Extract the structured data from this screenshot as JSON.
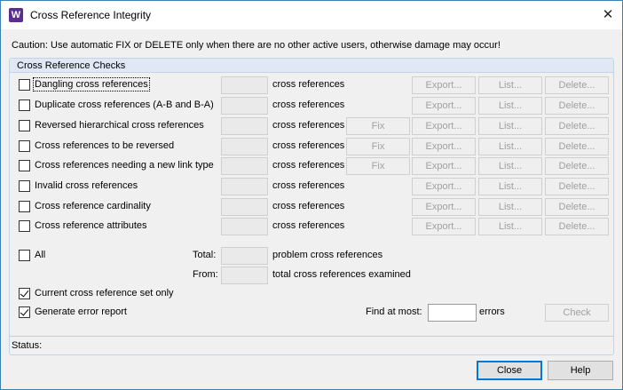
{
  "window": {
    "title": "Cross Reference Integrity",
    "app_icon_letter": "W",
    "close_glyph": "✕"
  },
  "caution": "Caution: Use automatic FIX or DELETE only when there are no other active users, otherwise damage may occur!",
  "group_title": "Cross Reference Checks",
  "suffix": "cross references",
  "buttons": {
    "fix": "Fix",
    "export": "Export...",
    "list": "List...",
    "delete": "Delete..."
  },
  "checks": [
    {
      "label": "Dangling cross references",
      "checked": false,
      "has_fix": false
    },
    {
      "label": "Duplicate cross references (A-B and B-A)",
      "checked": false,
      "has_fix": false
    },
    {
      "label": "Reversed hierarchical cross references",
      "checked": false,
      "has_fix": true
    },
    {
      "label": "Cross references to be reversed",
      "checked": false,
      "has_fix": true
    },
    {
      "label": "Cross references needing a new link type",
      "checked": false,
      "has_fix": true
    },
    {
      "label": "Invalid cross references",
      "checked": false,
      "has_fix": false
    },
    {
      "label": "Cross reference cardinality",
      "checked": false,
      "has_fix": false
    },
    {
      "label": "Cross reference attributes",
      "checked": false,
      "has_fix": false
    }
  ],
  "all": {
    "label": "All",
    "checked": false
  },
  "totals": {
    "total_label": "Total:",
    "total_suffix": "problem cross references",
    "from_label": "From:",
    "from_suffix": "total cross references examined"
  },
  "options": {
    "current_set": {
      "label": "Current cross reference set only",
      "checked": true
    },
    "error_report": {
      "label": "Generate error report",
      "checked": true
    }
  },
  "find": {
    "label": "Find at most:",
    "value": "",
    "suffix": "errors",
    "check_button": "Check"
  },
  "status": {
    "label": "Status:"
  },
  "footer": {
    "close": "Close",
    "help": "Help"
  }
}
